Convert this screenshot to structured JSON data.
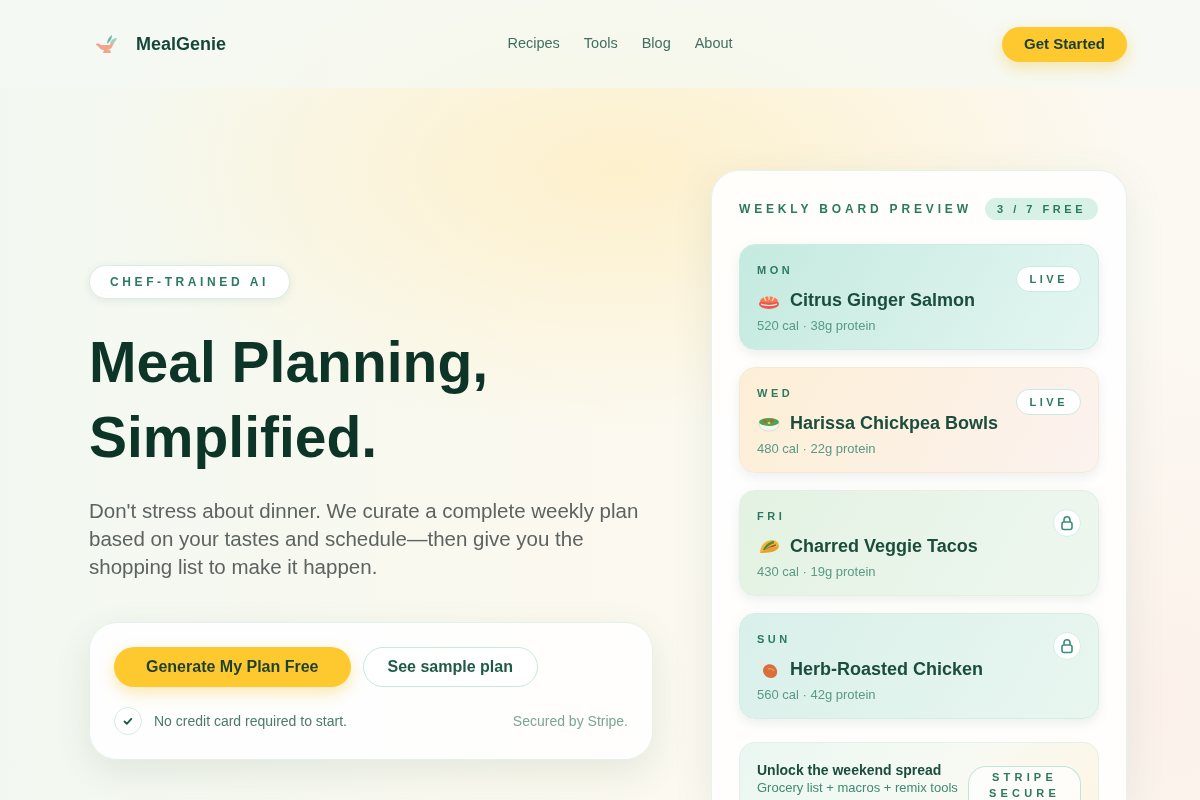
{
  "nav": {
    "brand": "MealGenie",
    "links": [
      {
        "label": "Recipes"
      },
      {
        "label": "Tools"
      },
      {
        "label": "Blog"
      },
      {
        "label": "About"
      }
    ],
    "cta": "Get Started"
  },
  "hero": {
    "badge": "CHEF-TRAINED AI",
    "title": "Meal Planning, Simplified.",
    "description": "Don't stress about dinner. We curate a complete weekly plan based on your tastes and schedule—then give you the shopping list to make it happen.",
    "primary_action": "Generate My Plan Free",
    "secondary_action": "See sample plan",
    "note": "No credit card required to start.",
    "security": "Secured by Stripe."
  },
  "board": {
    "title": "WEEKLY BOARD PREVIEW",
    "badge": "3 / 7 FREE",
    "meals": [
      {
        "day": "MON",
        "name": "Citrus Ginger Salmon",
        "meta": "520 cal · 38g protein",
        "locked": false,
        "status": "LIVE"
      },
      {
        "day": "WED",
        "name": "Harissa Chickpea Bowls",
        "meta": "480 cal · 22g protein",
        "locked": false,
        "status": "LIVE"
      },
      {
        "day": "FRI",
        "name": "Charred Veggie Tacos",
        "meta": "430 cal · 19g protein",
        "locked": true
      },
      {
        "day": "SUN",
        "name": "Herb-Roasted Chicken",
        "meta": "560 cal · 42g protein",
        "locked": true
      }
    ],
    "upsell": {
      "title": "Unlock the weekend spread",
      "text": "Grocery list + macros + remix tools",
      "badge": "STRIPE SECURE"
    }
  }
}
